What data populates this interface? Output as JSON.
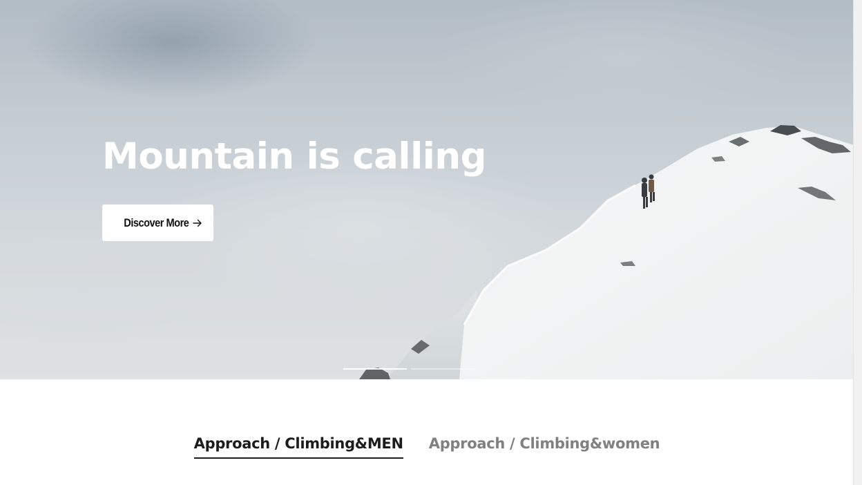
{
  "hero": {
    "title": "Mountain is calling",
    "cta_label": "Discover More",
    "cta_icon": "arrow-right-icon",
    "slides": [
      {
        "active": true
      },
      {
        "active": false
      }
    ]
  },
  "tabs": [
    {
      "label": "Approach / Climbing&MEN",
      "active": true
    },
    {
      "label": "Approach / Climbing&women",
      "active": false
    }
  ],
  "colors": {
    "accent_text": "#1c1c1c",
    "inactive_tab": "#808080",
    "button_bg": "#ffffff"
  }
}
